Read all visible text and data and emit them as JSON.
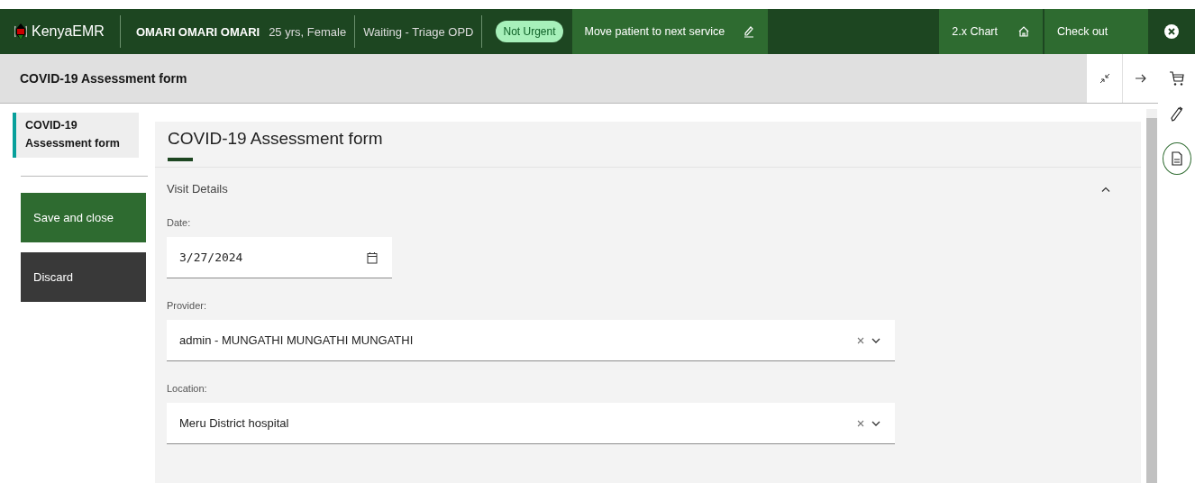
{
  "header": {
    "app_name": "KenyaEMR",
    "patient_name": "OMARI OMARI OMARI",
    "patient_details": "25 yrs, Female",
    "visit_status": "Waiting - Triage OPD",
    "priority_tag": "Not Urgent",
    "move_button": "Move patient to next service",
    "chart_button": "2.x Chart",
    "checkout_button": "Check out"
  },
  "workspace": {
    "title": "COVID-19 Assessment form"
  },
  "form_nav": [
    {
      "label": "COVID-19 Assessment form",
      "selected": true
    }
  ],
  "actions": [
    {
      "label": "Save and close",
      "kind": "primary"
    },
    {
      "label": "Discard",
      "kind": "secondary"
    }
  ],
  "form": {
    "title": "COVID-19 Assessment form",
    "sections": [
      {
        "title": "Visit Details",
        "expanded": true,
        "fields": [
          {
            "label": "Date:",
            "kind": "date",
            "value": "3/27/2024"
          },
          {
            "label": "Provider:",
            "kind": "select",
            "value": "admin - MUNGATHI MUNGATHI MUNGATHI"
          },
          {
            "label": "Location:",
            "kind": "select",
            "value": "Meru District hospital"
          }
        ]
      }
    ]
  }
}
